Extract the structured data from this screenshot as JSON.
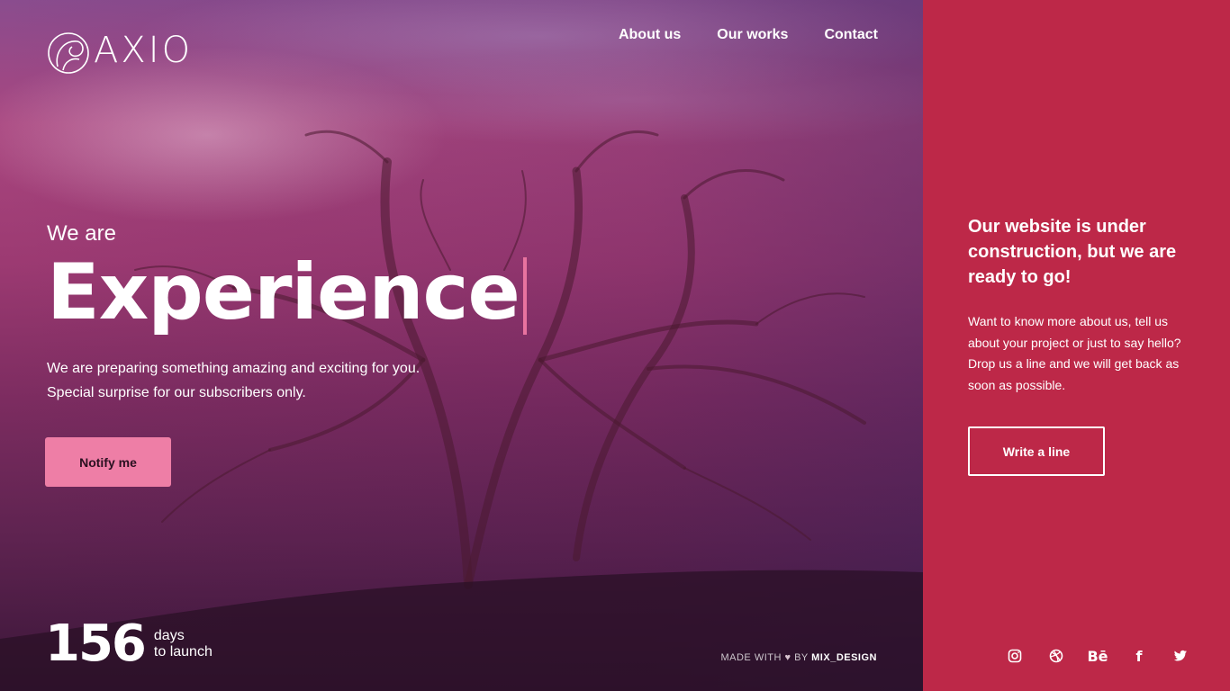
{
  "brand": {
    "name": "AXIO"
  },
  "nav": {
    "items": [
      "About us",
      "Our works",
      "Contact"
    ]
  },
  "hero": {
    "intro": "We are",
    "headline": "Experience",
    "subtitle_line1": "We are preparing something amazing and exciting for you.",
    "subtitle_line2": "Special surprise for our subscribers only.",
    "notify_label": "Notify me"
  },
  "countdown": {
    "number": "156",
    "unit": "days",
    "label": "to launch"
  },
  "footer": {
    "made_with": "MADE WITH",
    "by": "BY",
    "author": "MIX_DESIGN"
  },
  "side": {
    "title": "Our website is under construction, but we are ready to go!",
    "text": "Want to know more about us, tell us about your project or just to say hello? Drop us a line and we will get back as soon as possible.",
    "button_label": "Write a line"
  },
  "social": {
    "icons": [
      "instagram-icon",
      "dribbble-icon",
      "behance-icon",
      "facebook-icon",
      "twitter-icon"
    ],
    "behance_text": "Bē",
    "facebook_text": "f"
  },
  "colors": {
    "accent": "#bd2848",
    "button_pink": "#ee7ea6",
    "cursor": "#e8739f"
  }
}
